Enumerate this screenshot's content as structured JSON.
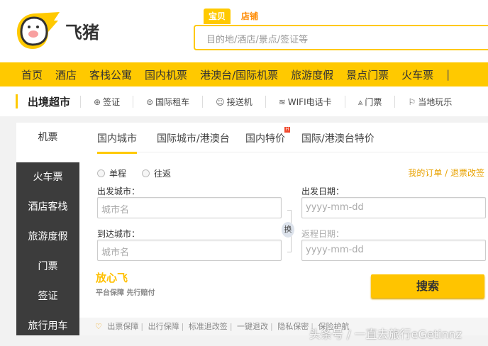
{
  "header": {
    "logo_text": "飞猪",
    "search_tabs": [
      "宝贝",
      "店铺"
    ],
    "search_placeholder": "目的地/酒店/景点/签证等"
  },
  "nav": {
    "items": [
      "首页",
      "酒店",
      "客栈公寓",
      "国内机票",
      "港澳台/国际机票",
      "旅游度假",
      "景点门票",
      "火车票"
    ]
  },
  "subnav": {
    "title": "出境超市",
    "items": [
      {
        "icon": "globe-icon",
        "label": "签证"
      },
      {
        "icon": "car-icon",
        "label": "国际租车"
      },
      {
        "icon": "shuttle-icon",
        "label": "接送机"
      },
      {
        "icon": "wifi-icon",
        "label": "WIFI电话卡"
      },
      {
        "icon": "tower-icon",
        "label": "门票"
      },
      {
        "icon": "flag-icon",
        "label": "当地玩乐"
      }
    ]
  },
  "side": {
    "active": "机票",
    "items": [
      "火车票",
      "酒店客栈",
      "旅游度假",
      "门票",
      "签证",
      "旅行用车"
    ]
  },
  "tabs": [
    "国内城市",
    "国际城市/港澳台",
    "国内特价",
    "国际/港澳台特价"
  ],
  "hot_badge": "H",
  "form": {
    "trip_types": [
      "单程",
      "往返"
    ],
    "links": "我的订单 / 退票改签",
    "from_label": "出发城市：",
    "to_label": "到达城市：",
    "depart_label": "出发日期：",
    "return_label": "返程日期：",
    "city_placeholder": "城市名",
    "date_placeholder": "yyyy-mm-dd",
    "swap": "换",
    "search": "搜索"
  },
  "guarantee": {
    "title": "放心飞",
    "subtitle": "平台保障 先行赔付"
  },
  "footer": [
    "出票保障",
    "出行保障",
    "标准退改签",
    "一键退改",
    "隐私保密",
    "保险护航"
  ],
  "watermark": "头条号 / 一直去旅行eGetinnz"
}
